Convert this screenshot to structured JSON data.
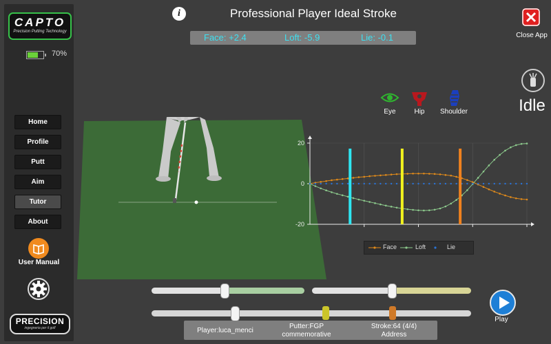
{
  "app": {
    "logo_text": "CAPTO",
    "logo_tagline": "Precision Putting Technology",
    "battery_pct": "70%",
    "battery_level": 0.7
  },
  "sidebar": {
    "items": [
      {
        "label": "Home",
        "active": false
      },
      {
        "label": "Profile",
        "active": false
      },
      {
        "label": "Putt",
        "active": false
      },
      {
        "label": "Aim",
        "active": false
      },
      {
        "label": "Tutor",
        "active": true
      },
      {
        "label": "About",
        "active": false
      }
    ],
    "manual_label": "User Manual",
    "footer_logo": "PRECISION",
    "footer_tagline": "ingegneria per il golf"
  },
  "header": {
    "title": "Professional Player Ideal Stroke",
    "info_icon": "i",
    "close_label": "Close App"
  },
  "metrics": {
    "face": "Face: +2.4",
    "loft": "Loft: -5.9",
    "lie": "Lie: -0.1"
  },
  "status": {
    "state": "Idle"
  },
  "body_parts": [
    {
      "label": "Eye",
      "icon": "eye-icon",
      "color": "#2fb52f"
    },
    {
      "label": "Hip",
      "icon": "hip-icon",
      "color": "#b8181e"
    },
    {
      "label": "Shoulder",
      "icon": "shoulder-icon",
      "color": "#1b3fbf"
    }
  ],
  "chart_data": {
    "type": "line",
    "ylim": [
      -20,
      20
    ],
    "yticks": [
      20,
      0,
      -20
    ],
    "x": [
      0,
      1,
      2,
      3,
      4,
      5,
      6,
      7,
      8,
      9,
      10,
      11,
      12,
      13,
      14,
      15,
      16,
      17,
      18,
      19,
      20,
      21,
      22,
      23,
      24,
      25,
      26,
      27,
      28,
      29,
      30,
      31,
      32,
      33,
      34,
      35,
      36,
      37,
      38,
      39,
      40
    ],
    "series": [
      {
        "name": "Face",
        "color": "#e08a1a",
        "values": [
          0,
          0.5,
          0.9,
          1.3,
          1.7,
          2.0,
          2.3,
          2.6,
          2.9,
          3.2,
          3.4,
          3.7,
          3.9,
          4.1,
          4.3,
          4.5,
          4.7,
          4.8,
          4.9,
          5.0,
          5.0,
          5.0,
          4.9,
          4.8,
          4.6,
          4.3,
          4.0,
          3.4,
          2.7,
          1.8,
          0.8,
          -0.4,
          -1.6,
          -2.8,
          -3.9,
          -4.9,
          -5.8,
          -6.6,
          -7.2,
          -7.6,
          -7.8
        ]
      },
      {
        "name": "Loft",
        "color": "#8cc98c",
        "values": [
          0,
          -1.2,
          -2.3,
          -3.3,
          -4.2,
          -5.0,
          -5.7,
          -6.4,
          -7.1,
          -7.8,
          -8.4,
          -9.0,
          -9.6,
          -10.2,
          -10.8,
          -11.3,
          -11.8,
          -12.2,
          -12.6,
          -12.9,
          -13.1,
          -13.2,
          -13.1,
          -12.8,
          -12.2,
          -11.2,
          -9.8,
          -8.0,
          -5.8,
          -3.2,
          -0.2,
          2.9,
          6.0,
          9.0,
          11.8,
          14.2,
          16.3,
          17.9,
          19.0,
          19.6,
          19.8
        ]
      },
      {
        "name": "Lie",
        "color": "#2a73d6",
        "values": [
          0,
          0,
          0,
          0,
          0,
          0,
          0,
          0,
          0,
          0,
          0,
          0,
          0,
          0,
          0,
          0,
          0,
          0,
          0,
          0,
          0,
          0,
          0,
          0,
          0,
          0,
          0,
          0,
          0,
          0,
          0,
          0,
          0,
          0,
          0,
          0,
          0,
          0,
          0,
          0,
          0
        ]
      }
    ],
    "markers": [
      {
        "x": 7.4,
        "color": "#2ee6f2"
      },
      {
        "x": 17.0,
        "color": "#f2f21e"
      },
      {
        "x": 27.7,
        "color": "#f0821e"
      }
    ]
  },
  "sliders": {
    "top_left": {
      "value": 0.5
    },
    "top_right": {
      "value": 0.5
    },
    "bottom": {
      "value": 0.26,
      "marker1": 0.55,
      "marker2": 0.76
    }
  },
  "playback": {
    "play_label": "Play"
  },
  "footer": {
    "player": "Player:luca_menci",
    "putter_line1": "Putter:FGP",
    "putter_line2": "commemorative",
    "stroke_line1": "Stroke:64 (4/4)",
    "stroke_line2": "Address"
  }
}
